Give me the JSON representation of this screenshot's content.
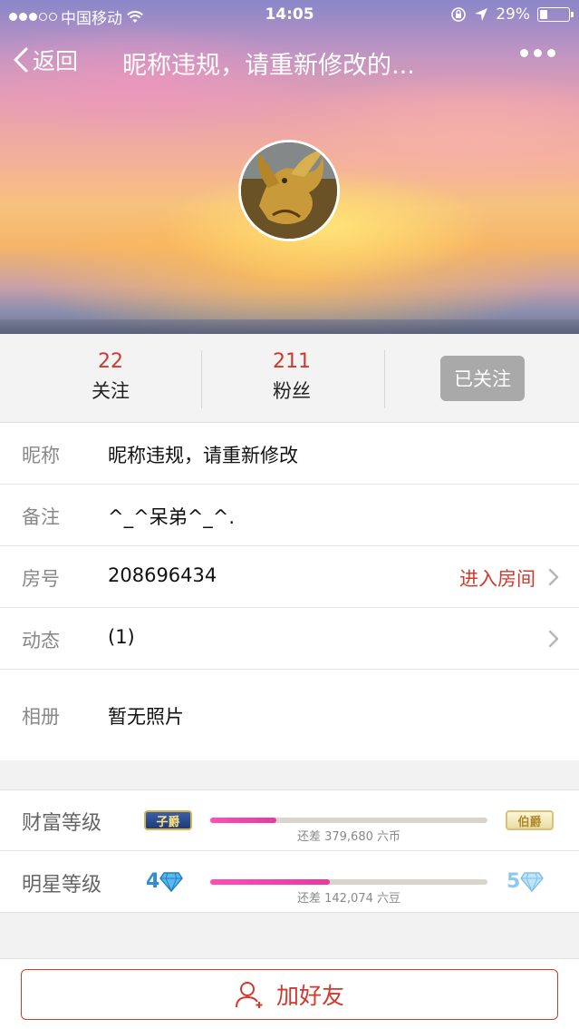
{
  "status_bar": {
    "carrier": "中国移动",
    "time": "14:05",
    "battery_text": "29%",
    "battery_level": 0.29
  },
  "nav": {
    "back_label": "返回",
    "title": "昵称违规，请重新修改的..."
  },
  "stats": {
    "following_count": "22",
    "following_label": "关注",
    "fans_count": "211",
    "fans_label": "粉丝",
    "follow_button": "已关注"
  },
  "info": {
    "nickname_label": "昵称",
    "nickname_value": "昵称违规，请重新修改",
    "remark_label": "备注",
    "remark_value": "^_^呆弟^_^.",
    "room_label": "房号",
    "room_value": "208696434",
    "room_link": "进入房间",
    "feed_label": "动态",
    "feed_value": "(1)",
    "album_label": "相册",
    "album_value": "暂无照片"
  },
  "levels": {
    "wealth": {
      "label": "财富等级",
      "current_badge": "子爵",
      "next_badge": "伯爵",
      "progress": 0.24,
      "note": "还差 379,680 六币"
    },
    "star": {
      "label": "明星等级",
      "current_level": "4",
      "next_level": "5",
      "progress": 0.43,
      "note": "还差 142,074 六豆"
    }
  },
  "footer": {
    "add_friend_label": "加好友"
  },
  "colors": {
    "accent_red": "#d0392c",
    "progress_pink": "#ff4db3",
    "button_gray": "#a9a9a9"
  }
}
